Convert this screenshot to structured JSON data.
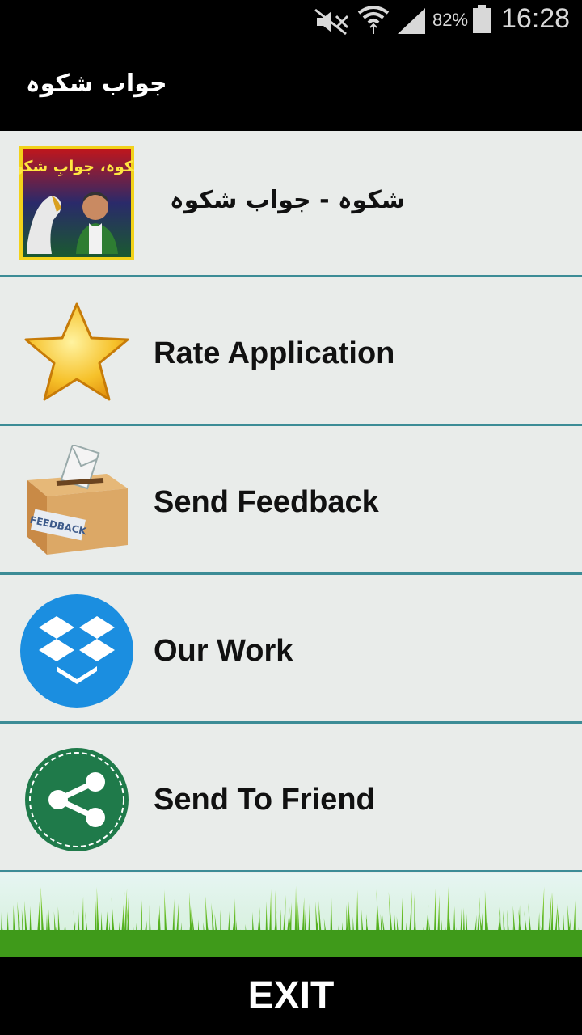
{
  "status_bar": {
    "battery_percent": "82%",
    "time": "16:28",
    "icons": [
      "mute-icon",
      "wifi-icon",
      "signal-icon",
      "battery-icon"
    ]
  },
  "app_bar": {
    "title": "جواب شکوہ"
  },
  "menu": {
    "header": {
      "label": "شکوہ - جواب شکوہ",
      "icon": "book-cover-thumbnail",
      "thumbnail_text": "شکوہ، جوابِ شکوہ"
    },
    "items": [
      {
        "label": "Rate Application",
        "icon": "star-icon"
      },
      {
        "label": "Send Feedback",
        "icon": "feedback-box-icon",
        "icon_text": "FEEDBACK"
      },
      {
        "label": "Our Work",
        "icon": "dropbox-icon"
      },
      {
        "label": "Send To Friend",
        "icon": "share-icon"
      }
    ]
  },
  "footer": {
    "exit_label": "EXIT"
  },
  "colors": {
    "row_background": "#e9ecea",
    "row_divider": "#3c8c96",
    "bars": "#000000"
  }
}
